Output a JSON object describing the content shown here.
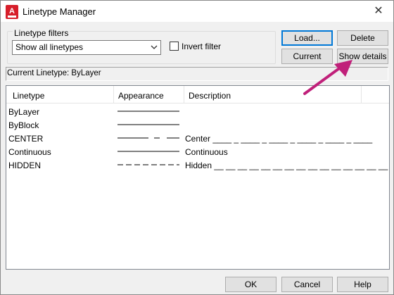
{
  "window": {
    "title": "Linetype Manager",
    "close_glyph": "✕",
    "icon": "autocad-app-icon"
  },
  "filters": {
    "group_label": "Linetype filters",
    "selected": "Show all linetypes",
    "invert_label": "Invert filter",
    "invert_checked": false
  },
  "buttons": {
    "load": "Load...",
    "delete": "Delete",
    "current": "Current",
    "show_details": "Show details",
    "ok": "OK",
    "cancel": "Cancel",
    "help": "Help"
  },
  "current_linetype": "Current Linetype:  ByLayer",
  "table": {
    "columns": [
      "Linetype",
      "Appearance",
      "Description"
    ],
    "rows": [
      {
        "name": "ByLayer",
        "appearance": "solid",
        "description": ""
      },
      {
        "name": "ByBlock",
        "appearance": "solid",
        "description": ""
      },
      {
        "name": "CENTER",
        "appearance": "center",
        "description": "Center ____ _ ____ _ ____ _ ____ _ ____ _ ____"
      },
      {
        "name": "Continuous",
        "appearance": "solid",
        "description": "Continuous"
      },
      {
        "name": "HIDDEN",
        "appearance": "hidden",
        "description": "Hidden __ __ __ __ __ __ __ __ __ __ __ __ __ __ __"
      }
    ]
  },
  "colors": {
    "accent_border": "#0078d7",
    "arrow": "#c0207a",
    "icon_red": "#d71e2a"
  }
}
